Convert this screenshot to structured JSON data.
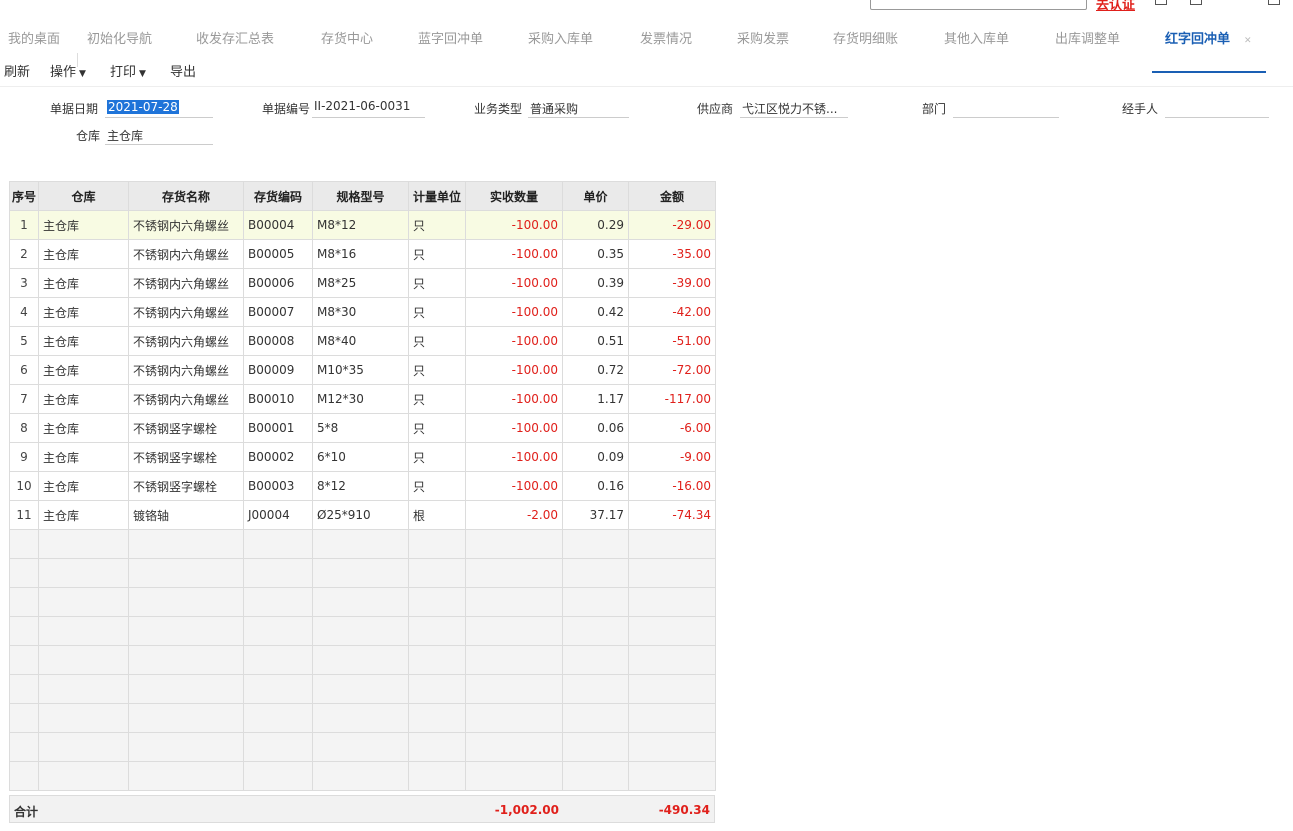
{
  "browser": {
    "cert_label": "去认证"
  },
  "tabs": [
    {
      "label": "我的桌面"
    },
    {
      "label": "初始化导航"
    },
    {
      "label": "收发存汇总表"
    },
    {
      "label": "存货中心"
    },
    {
      "label": "蓝字回冲单"
    },
    {
      "label": "采购入库单"
    },
    {
      "label": "发票情况"
    },
    {
      "label": "采购发票"
    },
    {
      "label": "存货明细账"
    },
    {
      "label": "其他入库单"
    },
    {
      "label": "出库调整单"
    },
    {
      "label": "红字回冲单",
      "active": true
    }
  ],
  "toolbar": {
    "refresh": "刷新",
    "operate": "操作",
    "print": "打印",
    "export": "导出"
  },
  "form": {
    "date_label": "单据日期",
    "date_value": "2021-07-28",
    "no_label": "单据编号",
    "no_value": "II-2021-06-0031",
    "biz_label": "业务类型",
    "biz_value": "普通采购",
    "supplier_label": "供应商",
    "supplier_value": "弋江区悦力不锈...",
    "dept_label": "部门",
    "dept_value": "",
    "handler_label": "经手人",
    "handler_value": "",
    "wh_label": "仓库",
    "wh_value": "主仓库"
  },
  "table": {
    "headers": [
      "序号",
      "仓库",
      "存货名称",
      "存货编码",
      "规格型号",
      "计量单位",
      "实收数量",
      "单价",
      "金额"
    ],
    "rows": [
      {
        "idx": "1",
        "wh": "主仓库",
        "name": "不锈钢内六角螺丝",
        "code": "B00004",
        "spec": "M8*12",
        "unit": "只",
        "qty": "-100.00",
        "price": "0.29",
        "amount": "-29.00"
      },
      {
        "idx": "2",
        "wh": "主仓库",
        "name": "不锈钢内六角螺丝",
        "code": "B00005",
        "spec": "M8*16",
        "unit": "只",
        "qty": "-100.00",
        "price": "0.35",
        "amount": "-35.00"
      },
      {
        "idx": "3",
        "wh": "主仓库",
        "name": "不锈钢内六角螺丝",
        "code": "B00006",
        "spec": "M8*25",
        "unit": "只",
        "qty": "-100.00",
        "price": "0.39",
        "amount": "-39.00"
      },
      {
        "idx": "4",
        "wh": "主仓库",
        "name": "不锈钢内六角螺丝",
        "code": "B00007",
        "spec": "M8*30",
        "unit": "只",
        "qty": "-100.00",
        "price": "0.42",
        "amount": "-42.00"
      },
      {
        "idx": "5",
        "wh": "主仓库",
        "name": "不锈钢内六角螺丝",
        "code": "B00008",
        "spec": "M8*40",
        "unit": "只",
        "qty": "-100.00",
        "price": "0.51",
        "amount": "-51.00"
      },
      {
        "idx": "6",
        "wh": "主仓库",
        "name": "不锈钢内六角螺丝",
        "code": "B00009",
        "spec": "M10*35",
        "unit": "只",
        "qty": "-100.00",
        "price": "0.72",
        "amount": "-72.00"
      },
      {
        "idx": "7",
        "wh": "主仓库",
        "name": "不锈钢内六角螺丝",
        "code": "B00010",
        "spec": "M12*30",
        "unit": "只",
        "qty": "-100.00",
        "price": "1.17",
        "amount": "-117.00"
      },
      {
        "idx": "8",
        "wh": "主仓库",
        "name": "不锈钢竖字螺栓",
        "code": "B00001",
        "spec": "5*8",
        "unit": "只",
        "qty": "-100.00",
        "price": "0.06",
        "amount": "-6.00"
      },
      {
        "idx": "9",
        "wh": "主仓库",
        "name": "不锈钢竖字螺栓",
        "code": "B00002",
        "spec": "6*10",
        "unit": "只",
        "qty": "-100.00",
        "price": "0.09",
        "amount": "-9.00"
      },
      {
        "idx": "10",
        "wh": "主仓库",
        "name": "不锈钢竖字螺栓",
        "code": "B00003",
        "spec": "8*12",
        "unit": "只",
        "qty": "-100.00",
        "price": "0.16",
        "amount": "-16.00"
      },
      {
        "idx": "11",
        "wh": "主仓库",
        "name": "镀铬轴",
        "code": "J00004",
        "spec": "Ø25*910",
        "unit": "根",
        "qty": "-2.00",
        "price": "37.17",
        "amount": "-74.34"
      }
    ],
    "total_label": "合计",
    "total_qty": "-1,002.00",
    "total_amount": "-490.34"
  },
  "colors": {
    "accent": "#1a5fb4",
    "negative": "#e0201b",
    "selected_row": "#f8fbe3"
  }
}
